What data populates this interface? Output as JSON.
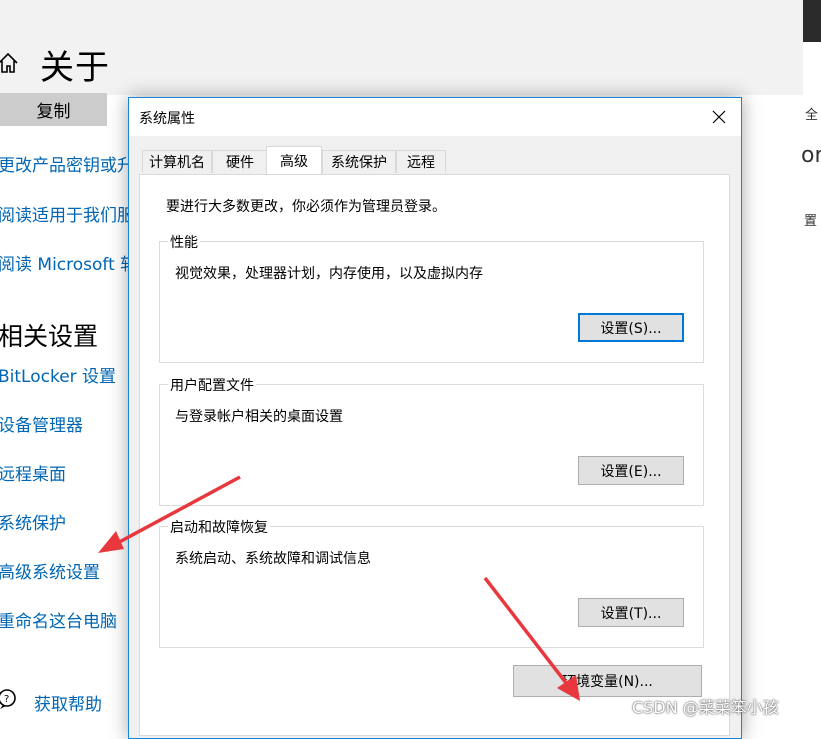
{
  "settings": {
    "title": "关于",
    "copy_button": "复制",
    "links": [
      "更改产品密钥或升",
      "阅读适用于我们服",
      "阅读 Microsoft 软"
    ],
    "related_title": "相关设置",
    "related_links": [
      "BitLocker 设置",
      "设备管理器",
      "远程桌面",
      "系统保护",
      "高级系统设置",
      "重命名这台电脑"
    ],
    "help_link": "获取帮助",
    "edge_fragments": [
      "全",
      "or",
      "置"
    ]
  },
  "dialog": {
    "title": "系统属性",
    "tabs": [
      "计算机名",
      "硬件",
      "高级",
      "系统保护",
      "远程"
    ],
    "active_tab": "高级",
    "admin_note": "要进行大多数更改，你必须作为管理员登录。",
    "groups": [
      {
        "label": "性能",
        "description": "视觉效果，处理器计划，内存使用，以及虚拟内存",
        "button": "设置(S)..."
      },
      {
        "label": "用户配置文件",
        "description": "与登录帐户相关的桌面设置",
        "button": "设置(E)..."
      },
      {
        "label": "启动和故障恢复",
        "description": "系统启动、系统故障和调试信息",
        "button": "设置(T)..."
      }
    ],
    "env_button": "环境变量(N)..."
  },
  "watermark": "CSDN @菜菜笨小孩",
  "colors": {
    "link": "#0066b4",
    "accent": "#0078d7",
    "arrow": "#e8383d"
  }
}
